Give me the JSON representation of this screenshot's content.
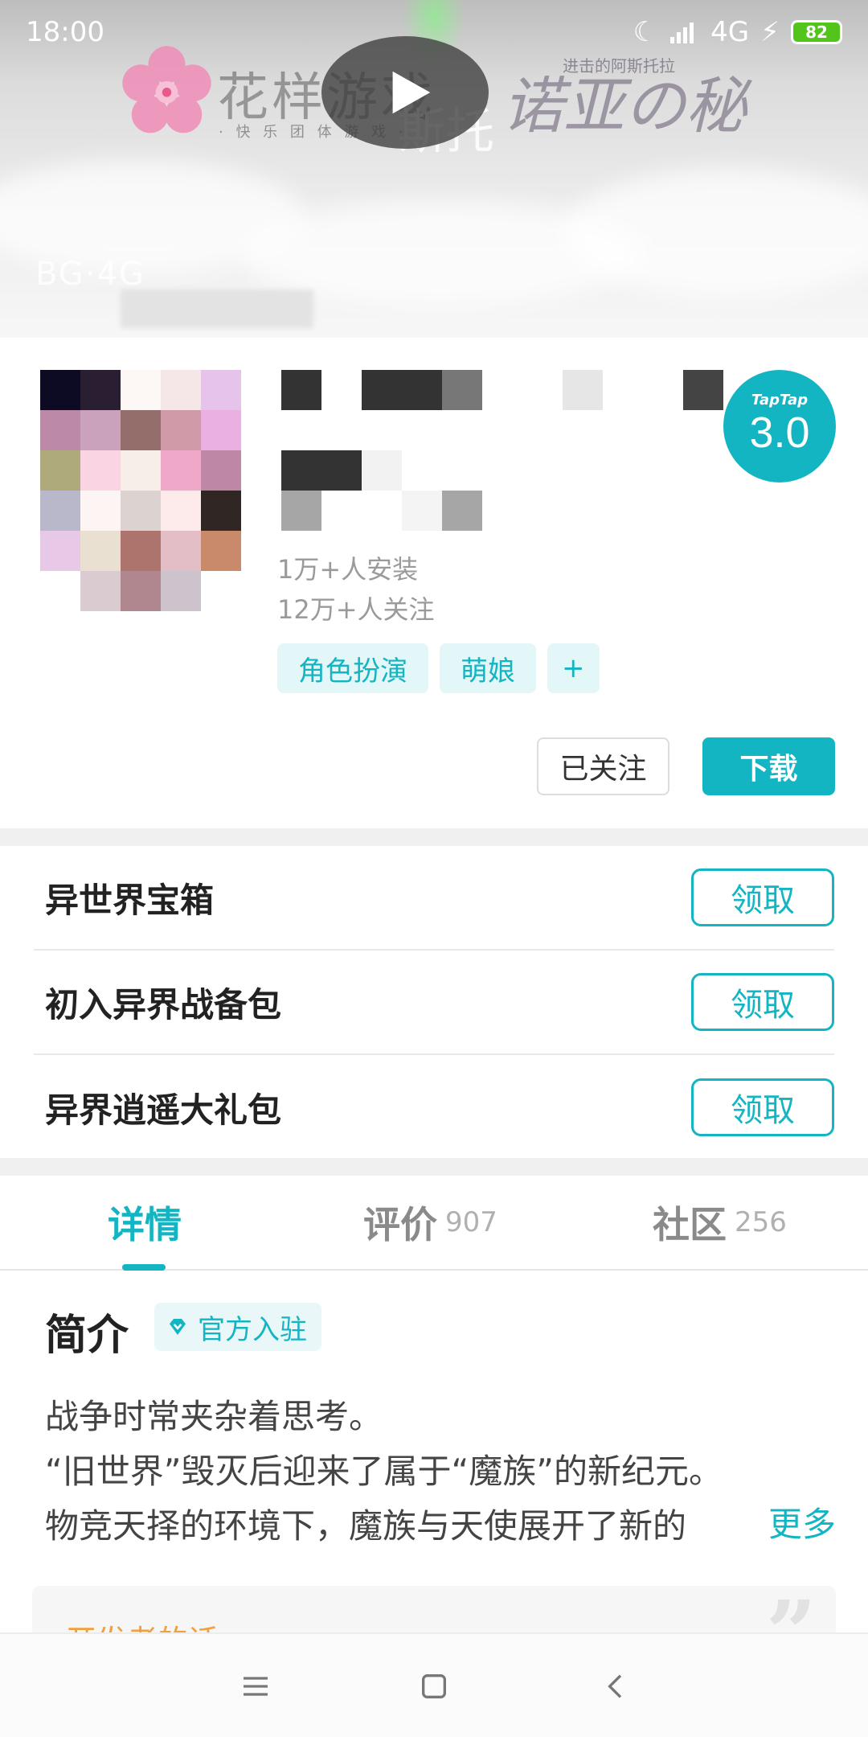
{
  "status_bar": {
    "time": "18:00",
    "network": "4G",
    "battery": "82"
  },
  "banner": {
    "logo_left": "花样游戏",
    "logo_left_sub": "· 快 乐 团 体 游 戏 ·",
    "logo_right": "诺亚の秘",
    "logo_right_sub": "进击的阿斯托拉",
    "overlay_text": "斯托",
    "mid_text": "BG·4G"
  },
  "app": {
    "installs": "1万+人安装",
    "follows": "12万+人关注",
    "tags": [
      "角色扮演",
      "萌娘",
      "+"
    ],
    "rating_brand": "TapTap",
    "rating_score": "3.0",
    "follow_label": "已关注",
    "download_label": "下载"
  },
  "gifts": [
    {
      "name": "异世界宝箱",
      "action": "领取"
    },
    {
      "name": "初入异界战备包",
      "action": "领取"
    },
    {
      "name": "异界逍遥大礼包",
      "action": "领取"
    }
  ],
  "tabs": [
    {
      "label": "详情",
      "count": ""
    },
    {
      "label": "评价",
      "count": "907"
    },
    {
      "label": "社区",
      "count": "256"
    }
  ],
  "intro": {
    "title": "简介",
    "badge": "官方入驻",
    "lines": [
      "战争时常夹杂着思考。",
      "“旧世界”毁灭后迎来了属于“魔族”的新纪元。",
      "物竞天择的环境下，魔族与天使展开了新的"
    ],
    "more": "更多"
  },
  "developer_note": {
    "title": "开发者的话"
  },
  "colors": {
    "accent": "#14b5c3",
    "tag_bg": "#e3f6f8",
    "dev_title": "#f0a03c"
  }
}
